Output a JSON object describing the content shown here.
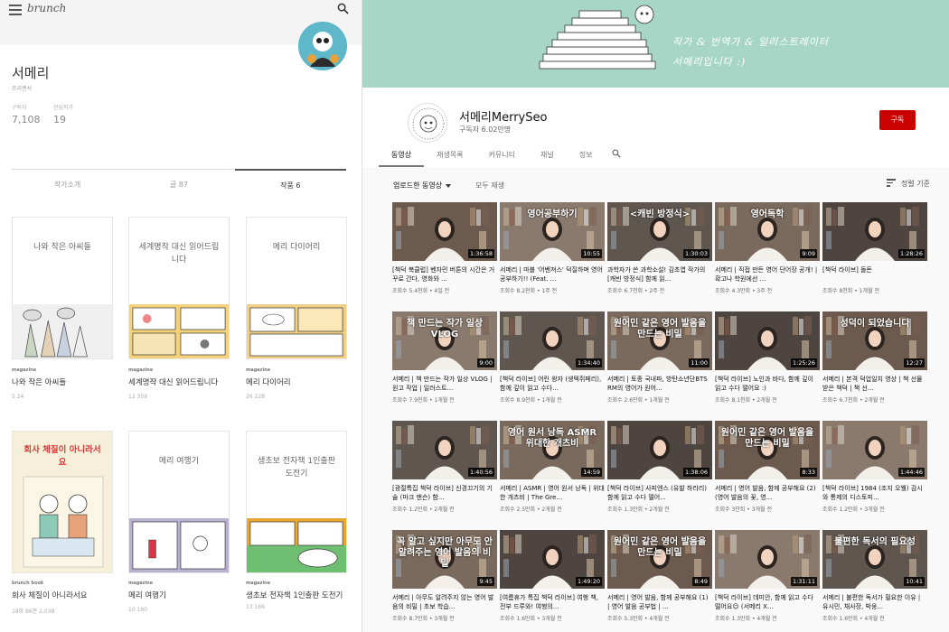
{
  "brunch": {
    "logo": "brunch",
    "author_name": "서메리",
    "author_role": "프리랜서",
    "stats": [
      {
        "label": "구독자",
        "value": "7,108"
      },
      {
        "label": "관심작가",
        "value": "19"
      }
    ],
    "tabs": [
      {
        "label": "작가소개",
        "active": false
      },
      {
        "label": "글 87",
        "active": false
      },
      {
        "label": "작품 6",
        "active": true
      }
    ],
    "cards": [
      {
        "cover_title": "나와 작은 아씨들",
        "tag": "magazine",
        "title": "나와 작은 아씨들",
        "stats": "5  24"
      },
      {
        "cover_title": "세계명작 대신 읽어드립니다",
        "tag": "magazine",
        "title": "세계명작 대신 읽어드립니다",
        "stats": "12  359"
      },
      {
        "cover_title": "메리 다이어리",
        "tag": "magazine",
        "title": "메리 다이어리",
        "stats": "26  228"
      },
      {
        "cover_title": "회사 체질이 아니라서요",
        "tag": "brunch book",
        "title": "회사 체질이 아니라서요",
        "stats": "18화  86분  2,038"
      },
      {
        "cover_title": "메리 여행기",
        "tag": "magazine",
        "title": "메리 여행기",
        "stats": "10  160"
      },
      {
        "cover_title": "생초보 전자책 1인출판 도전기",
        "tag": "magazine",
        "title": "생초보 전자책 1인출판 도전기",
        "stats": "13  169"
      }
    ]
  },
  "youtube": {
    "banner_line1": "작가 & 번역가 & 일러스트레이터",
    "banner_line2": "서메리입니다 :)",
    "channel_name": "서메리MerrySeo",
    "subscribers": "구독자 6.02만명",
    "subscribe_label": "구독",
    "tabs": [
      {
        "label": "동영상",
        "active": true
      },
      {
        "label": "재생목록",
        "active": false
      },
      {
        "label": "커뮤니티",
        "active": false
      },
      {
        "label": "채널",
        "active": false
      },
      {
        "label": "정보",
        "active": false
      }
    ],
    "uploaded_label": "업로드한 동영상",
    "play_all_label": "모두 재생",
    "sort_label": "정렬 기준",
    "videos": [
      {
        "title": "[책덕 북클럽] 벤자민 버튼의 시간은 거꾸로 간다, 영화와 ...",
        "meta": "조회수 5.4천회 • 4일 전",
        "duration": "1:36:58",
        "overlay": ""
      },
      {
        "title": "서메리 | 마블 '어벤져스' 덕질하며 영어 공부하기!! (Feat. ...",
        "meta": "조회수 8.2천회 • 1주 전",
        "duration": "10:55",
        "overlay": "영어공부하기"
      },
      {
        "title": "과학자가 쓴 과학소설! 김초엽 작가의 [캐빈 방정식] 함께 읽...",
        "meta": "조회수 6.7천회 • 2주 전",
        "duration": "1:30:03",
        "overlay": "<캐빈 방정식>"
      },
      {
        "title": "서메리 | 직접 만든 영어 단어장 공개! | 확고나 학원에선 ...",
        "meta": "조회수 4.3만회 • 3주 전",
        "duration": "9:09",
        "overlay": "영어독학"
      },
      {
        "title": "[책덕 라이브] 돌돈",
        "meta": "조회수 8천회 • 1개월 전",
        "duration": "1:28:26",
        "overlay": ""
      },
      {
        "title": "서메리 | 책 만드는 작가 일상 VLOG | 원고 작업 | 일러스트...",
        "meta": "조회수 7.9천회 • 1개월 전",
        "duration": "9:00",
        "overlay": "책 만드는 작가 일상 VLOG"
      },
      {
        "title": "[책덕 라이브] 어린 왕자 (생텍쥐페리), 함께 깊이 읽고 수다...",
        "meta": "조회수 8.9천회 • 1개월 전",
        "duration": "1:34:40",
        "overlay": ""
      },
      {
        "title": "서메리 | 토종 국내파, 방탄소년단BTS RM의 영어가 원어...",
        "meta": "조회수 2.6만회 • 1개월 전",
        "duration": "11:00",
        "overlay": "원어민 같은 영어 발음을 만드는 비밀"
      },
      {
        "title": "[책덕 라이브] 노인과 바다, 함께 깊이 읽고 수다 떨어요 :)",
        "meta": "조회수 8.1천회 • 2개월 전",
        "duration": "1:25:26",
        "overlay": ""
      },
      {
        "title": "서메리 | 본격 덕업일치 영상 | 책 선물 받은 책덕 | 책 선...",
        "meta": "조회수 6.7천회 • 2개월 전",
        "duration": "12:27",
        "overlay": "성덕이 되었습니다"
      },
      {
        "title": "[광절특집 책덕 라이브] 신경끄기의 기술 (마크 맨슨) 함...",
        "meta": "조회수 1.2만회 • 2개월 전",
        "duration": "1:40:56",
        "overlay": ""
      },
      {
        "title": "서메리 | ASMR | 영어 원서 낭독 | 위대한 개츠비 | The Gre...",
        "meta": "조회수 2.5만회 • 2개월 전",
        "duration": "14:59",
        "overlay": "영어 원서 낭독 ASMR 위대한 개츠비"
      },
      {
        "title": "[책덕 라이브] 사피엔스 (유발 하라리) 함께 읽고 수다 떨어...",
        "meta": "조회수 1.3만회 • 2개월 전",
        "duration": "1:38:06",
        "overlay": ""
      },
      {
        "title": "서메리 | 영어 발음, 함께 공부해요 (2) (영어 발음의 꽃, 영...",
        "meta": "조회수 3만회 • 3개월 전",
        "duration": "8:33",
        "overlay": "원어민 같은 영어 발음을 만드는 비밀"
      },
      {
        "title": "[책덕 라이브] 1984 (조지 오웰) 감시와 통제의 디스토피...",
        "meta": "조회수 1.2만회 • 3개월 전",
        "duration": "1:44:46",
        "overlay": ""
      },
      {
        "title": "서메리 | 아무도 알려주지 않는 영어 발음의 비밀 | 초보 학습...",
        "meta": "조회수 8.7만회 • 3개월 전",
        "duration": "9:45",
        "overlay": "꼭 알고 싶지만 아무도 안 알려주는 영어 발음의 비밀"
      },
      {
        "title": "[여름휴가 특집 책덕 라이브] 여행 책, 전부 드루와! 여행의...",
        "meta": "조회수 1.6만회 • 3개월 전",
        "duration": "1:49:20",
        "overlay": ""
      },
      {
        "title": "서메리 | 영어 발음, 함께 공부해요 (1) | 영어 발음 공부법 | ...",
        "meta": "조회수 5.3만회 • 4개월 전",
        "duration": "8:49",
        "overlay": "원어민 같은 영어 발음을 만드는 비밀"
      },
      {
        "title": "[책덕 라이브] 데미안, 함께 읽고 수다 떨어요☺ (서메리 X...",
        "meta": "조회수 1.3만회 • 4개월 전",
        "duration": "1:31:11",
        "overlay": ""
      },
      {
        "title": "서메리 | 불편한 독서가 필요한 이유 | 유시민, 채사장, 박웅...",
        "meta": "조회수 1.6만회 • 4개월 전",
        "duration": "10:41",
        "overlay": "불편한 독서의 필요성"
      }
    ]
  }
}
